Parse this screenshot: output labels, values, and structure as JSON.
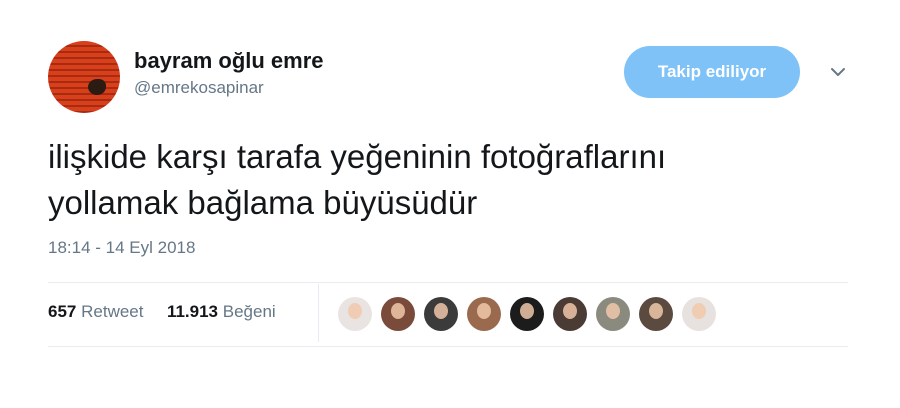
{
  "user": {
    "name": "bayram oğlu emre",
    "handle": "@emrekosapinar"
  },
  "follow_button": {
    "label": "Takip ediliyor",
    "color": "#7ec2f7"
  },
  "menu": {
    "icon": "chevron-down-icon"
  },
  "tweet": {
    "line1": "ilişkide karşı tarafa yeğeninin fotoğraflarını",
    "line2": "yollamak bağlama büyüsüdür",
    "timestamp": "18:14 - 14 Eyl 2018"
  },
  "stats": {
    "retweets_count": "657",
    "retweets_label": "Retweet",
    "likes_count": "11.913",
    "likes_label": "Beğeni"
  },
  "likers": [
    {
      "color": "#e9e4e2"
    },
    {
      "color": "#7a4b3a"
    },
    {
      "color": "#3b3b3b"
    },
    {
      "color": "#9a6a4e"
    },
    {
      "color": "#1c1c1c"
    },
    {
      "color": "#4a3b34"
    },
    {
      "color": "#8a8a7e"
    },
    {
      "color": "#5b4a3f"
    },
    {
      "color": "#e7e2df"
    }
  ]
}
